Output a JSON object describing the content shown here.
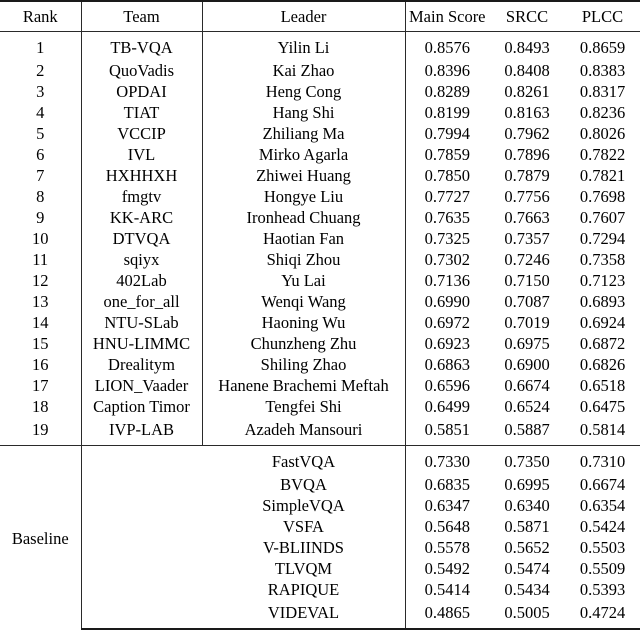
{
  "table": {
    "caption_present": false,
    "columns": [
      {
        "key": "rank",
        "label": "Rank"
      },
      {
        "key": "team",
        "label": "Team"
      },
      {
        "key": "leader",
        "label": "Leader"
      },
      {
        "key": "main",
        "label": "Main Score"
      },
      {
        "key": "srcc",
        "label": "SRCC"
      },
      {
        "key": "plcc",
        "label": "PLCC"
      }
    ],
    "rows": [
      {
        "rank": "1",
        "team": "TB-VQA",
        "leader": "Yilin Li",
        "main": "0.8576",
        "srcc": "0.8493",
        "plcc": "0.8659"
      },
      {
        "rank": "2",
        "team": "QuoVadis",
        "leader": "Kai Zhao",
        "main": "0.8396",
        "srcc": "0.8408",
        "plcc": "0.8383"
      },
      {
        "rank": "3",
        "team": "OPDAI",
        "leader": "Heng Cong",
        "main": "0.8289",
        "srcc": "0.8261",
        "plcc": "0.8317"
      },
      {
        "rank": "4",
        "team": "TIAT",
        "leader": "Hang Shi",
        "main": "0.8199",
        "srcc": "0.8163",
        "plcc": "0.8236"
      },
      {
        "rank": "5",
        "team": "VCCIP",
        "leader": "Zhiliang Ma",
        "main": "0.7994",
        "srcc": "0.7962",
        "plcc": "0.8026"
      },
      {
        "rank": "6",
        "team": "IVL",
        "leader": "Mirko Agarla",
        "main": "0.7859",
        "srcc": "0.7896",
        "plcc": "0.7822"
      },
      {
        "rank": "7",
        "team": "HXHHXH",
        "leader": "Zhiwei Huang",
        "main": "0.7850",
        "srcc": "0.7879",
        "plcc": "0.7821"
      },
      {
        "rank": "8",
        "team": "fmgtv",
        "leader": "Hongye Liu",
        "main": "0.7727",
        "srcc": "0.7756",
        "plcc": "0.7698"
      },
      {
        "rank": "9",
        "team": "KK-ARC",
        "leader": "Ironhead Chuang",
        "main": "0.7635",
        "srcc": "0.7663",
        "plcc": "0.7607"
      },
      {
        "rank": "10",
        "team": "DTVQA",
        "leader": "Haotian Fan",
        "main": "0.7325",
        "srcc": "0.7357",
        "plcc": "0.7294"
      },
      {
        "rank": "11",
        "team": "sqiyx",
        "leader": "Shiqi Zhou",
        "main": "0.7302",
        "srcc": "0.7246",
        "plcc": "0.7358"
      },
      {
        "rank": "12",
        "team": "402Lab",
        "leader": "Yu Lai",
        "main": "0.7136",
        "srcc": "0.7150",
        "plcc": "0.7123"
      },
      {
        "rank": "13",
        "team": "one_for_all",
        "leader": "Wenqi Wang",
        "main": "0.6990",
        "srcc": "0.7087",
        "plcc": "0.6893"
      },
      {
        "rank": "14",
        "team": "NTU-SLab",
        "leader": "Haoning Wu",
        "main": "0.6972",
        "srcc": "0.7019",
        "plcc": "0.6924"
      },
      {
        "rank": "15",
        "team": "HNU-LIMMC",
        "leader": "Chunzheng Zhu",
        "main": "0.6923",
        "srcc": "0.6975",
        "plcc": "0.6872"
      },
      {
        "rank": "16",
        "team": "Drealitym",
        "leader": "Shiling Zhao",
        "main": "0.6863",
        "srcc": "0.6900",
        "plcc": "0.6826"
      },
      {
        "rank": "17",
        "team": "LION_Vaader",
        "leader": "Hanene Brachemi Meftah",
        "main": "0.6596",
        "srcc": "0.6674",
        "plcc": "0.6518"
      },
      {
        "rank": "18",
        "team": "Caption Timor",
        "leader": "Tengfei Shi",
        "main": "0.6499",
        "srcc": "0.6524",
        "plcc": "0.6475"
      },
      {
        "rank": "19",
        "team": "IVP-LAB",
        "leader": "Azadeh Mansouri",
        "main": "0.5851",
        "srcc": "0.5887",
        "plcc": "0.5814"
      }
    ],
    "baseline": {
      "label": "Baseline",
      "rows": [
        {
          "method": "FastVQA",
          "main": "0.7330",
          "srcc": "0.7350",
          "plcc": "0.7310"
        },
        {
          "method": "BVQA",
          "main": "0.6835",
          "srcc": "0.6995",
          "plcc": "0.6674"
        },
        {
          "method": "SimpleVQA",
          "main": "0.6347",
          "srcc": "0.6340",
          "plcc": "0.6354"
        },
        {
          "method": "VSFA",
          "main": "0.5648",
          "srcc": "0.5871",
          "plcc": "0.5424"
        },
        {
          "method": "V-BLIINDS",
          "main": "0.5578",
          "srcc": "0.5652",
          "plcc": "0.5503"
        },
        {
          "method": "TLVQM",
          "main": "0.5492",
          "srcc": "0.5474",
          "plcc": "0.5509"
        },
        {
          "method": "RAPIQUE",
          "main": "0.5414",
          "srcc": "0.5434",
          "plcc": "0.5393"
        },
        {
          "method": "VIDEVAL",
          "main": "0.4865",
          "srcc": "0.5005",
          "plcc": "0.4724"
        }
      ]
    },
    "style": {
      "rule_color": "#1a1a1a",
      "text_color": "#000000",
      "background": "#ffffff"
    }
  }
}
